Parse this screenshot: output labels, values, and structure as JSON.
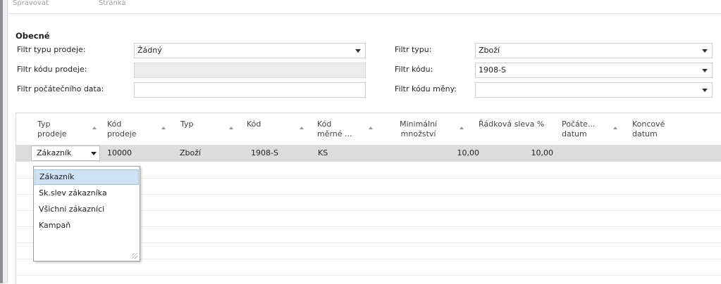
{
  "top_menu": [
    "Spravovat",
    "Stránka"
  ],
  "section_title": "Obecné",
  "filters": {
    "sales_type": {
      "label": "Filtr typu prodeje:",
      "value": "Žádný"
    },
    "sales_code": {
      "label": "Filtr kódu prodeje:",
      "value": ""
    },
    "start_date": {
      "label": "Filtr počátečního data:",
      "value": ""
    },
    "type": {
      "label": "Filtr typu:",
      "value": "Zboží"
    },
    "code": {
      "label": "Filtr kódu:",
      "value": "1908-S"
    },
    "currency": {
      "label": "Filtr kódu měny:",
      "value": ""
    }
  },
  "columns": [
    {
      "l1": "Typ",
      "l2": "prodeje"
    },
    {
      "l1": "Kód",
      "l2": "prodeje"
    },
    {
      "l1": "Typ",
      "l2": ""
    },
    {
      "l1": "Kód",
      "l2": ""
    },
    {
      "l1": "Kód",
      "l2": "měrné ..."
    },
    {
      "l1": "Minimální",
      "l2": "množství"
    },
    {
      "l1": "Řádková sleva %",
      "l2": ""
    },
    {
      "l1": "Počáte...",
      "l2": "datum"
    },
    {
      "l1": "Koncové",
      "l2": "datum"
    }
  ],
  "row": {
    "sales_type": "Zákazník",
    "sales_code": "10000",
    "type": "Zboží",
    "code": "1908-S",
    "uom": "KS",
    "min_qty": "10,00",
    "line_discount": "10,00",
    "start_date": "",
    "end_date": ""
  },
  "dropdown_options": [
    "Zákazník",
    "Sk.slev zákazníka",
    "Všichni zákazníci",
    "Kampaň"
  ],
  "colors": {
    "selected_row": "#dcdcdc",
    "highlight_option": "#cfe3f7"
  }
}
